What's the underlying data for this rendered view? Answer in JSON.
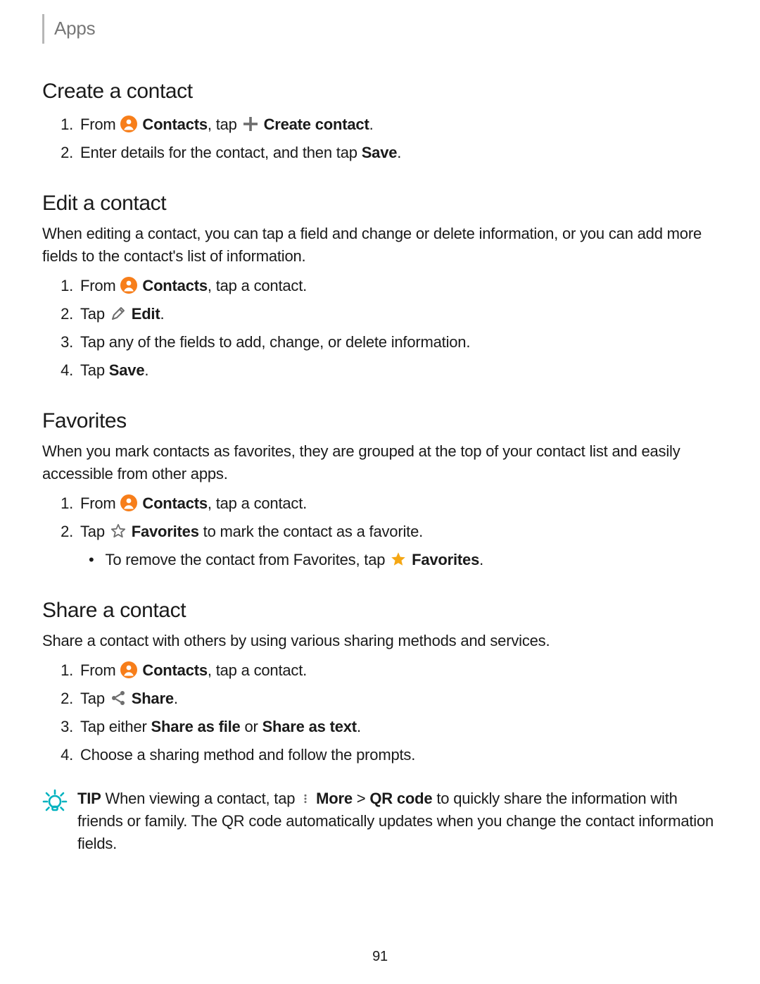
{
  "breadcrumb": "Apps",
  "page_number": "91",
  "icons": {
    "contacts": "contacts-icon",
    "plus": "plus-icon",
    "edit": "edit-icon",
    "star_outline": "star-outline-icon",
    "star_filled": "star-filled-icon",
    "share": "share-icon",
    "more": "more-icon",
    "tip": "lightbulb-icon"
  },
  "s1": {
    "title": "Create a contact",
    "step1_a": "From ",
    "step1_b": "Contacts",
    "step1_c": ", tap ",
    "step1_d": "Create contact",
    "step1_e": ".",
    "step2_a": "Enter details for the contact, and then tap ",
    "step2_b": "Save",
    "step2_c": "."
  },
  "s2": {
    "title": "Edit a contact",
    "intro": "When editing a contact, you can tap a field and change or delete information, or you can add more fields to the contact's list of information.",
    "step1_a": "From ",
    "step1_b": "Contacts",
    "step1_c": ", tap a contact.",
    "step2_a": "Tap ",
    "step2_b": "Edit",
    "step2_c": ".",
    "step3": "Tap any of the fields to add, change, or delete information.",
    "step4_a": "Tap ",
    "step4_b": "Save",
    "step4_c": "."
  },
  "s3": {
    "title": "Favorites",
    "intro": "When you mark contacts as favorites, they are grouped at the top of your contact list and easily accessible from other apps.",
    "step1_a": "From ",
    "step1_b": "Contacts",
    "step1_c": ", tap a contact.",
    "step2_a": "Tap ",
    "step2_b": "Favorites",
    "step2_c": " to mark the contact as a favorite.",
    "sub_a": "To remove the contact from Favorites, tap ",
    "sub_b": "Favorites",
    "sub_c": "."
  },
  "s4": {
    "title": "Share a contact",
    "intro": "Share a contact with others by using various sharing methods and services.",
    "step1_a": "From ",
    "step1_b": "Contacts",
    "step1_c": ", tap a contact.",
    "step2_a": "Tap ",
    "step2_b": "Share",
    "step2_c": ".",
    "step3_a": "Tap either ",
    "step3_b": "Share as file",
    "step3_c": " or ",
    "step3_d": "Share as text",
    "step3_e": ".",
    "step4": "Choose a sharing method and follow the prompts."
  },
  "tip": {
    "label": "TIP",
    "a": "  When viewing a contact, tap ",
    "b": "More",
    "c": " > ",
    "d": "QR code",
    "e": " to quickly share the information with friends or family. The QR code automatically updates when you change the contact information fields."
  }
}
